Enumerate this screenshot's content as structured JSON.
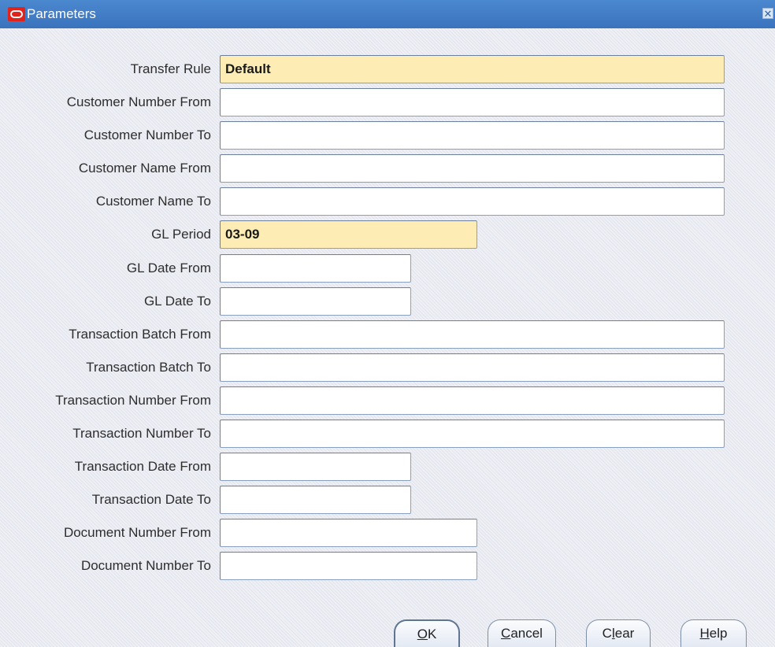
{
  "window": {
    "title": "Parameters",
    "close_glyph": "✕"
  },
  "fields": [
    {
      "label": "Transfer Rule",
      "value": "Default",
      "required": true
    },
    {
      "label": "Customer  Number From",
      "value": ""
    },
    {
      "label": "Customer Number To",
      "value": ""
    },
    {
      "label": "Customer Name From",
      "value": ""
    },
    {
      "label": "Customer Name To",
      "value": ""
    },
    {
      "label": "GL Period",
      "value": "03-09",
      "required": true
    },
    {
      "label": "GL Date From",
      "value": ""
    },
    {
      "label": "GL Date To",
      "value": ""
    },
    {
      "label": "Transaction Batch From",
      "value": ""
    },
    {
      "label": "Transaction Batch To",
      "value": ""
    },
    {
      "label": "Transaction Number From",
      "value": ""
    },
    {
      "label": "Transaction Number To",
      "value": ""
    },
    {
      "label": "Transaction Date From",
      "value": ""
    },
    {
      "label": "Transaction Date To",
      "value": ""
    },
    {
      "label": "Document Number From",
      "value": ""
    },
    {
      "label": "Document Number To",
      "value": ""
    }
  ],
  "buttons": {
    "ok": {
      "mnemonic": "O",
      "rest": "K"
    },
    "cancel": {
      "mnemonic": "C",
      "rest": "ancel"
    },
    "clear": {
      "pre": "C",
      "mnemonic": "l",
      "rest": "ear"
    },
    "help": {
      "mnemonic": "H",
      "rest": "elp"
    }
  },
  "colors": {
    "titlebar": "#3a73bd",
    "required_field": "#fdedb4",
    "window_bg": "#eef0f5"
  }
}
